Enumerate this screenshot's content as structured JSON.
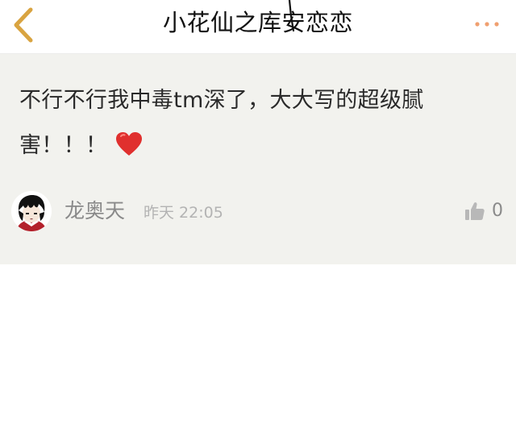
{
  "header": {
    "title": "小花仙之库安恋恋",
    "back_icon": "chevron-left-icon",
    "more_icon": "more-dots-icon",
    "accent_color": "#d9a441",
    "more_color": "#f0a070"
  },
  "comment": {
    "text": "不行不行我中毒tm深了，大大写的超级腻害！！！",
    "emoji_icon": "red-heart-icon",
    "author": "龙奥天",
    "timestamp": "昨天 22:05",
    "like_icon": "thumbs-up-icon",
    "like_count": "0",
    "background_color": "#f2f2ee"
  }
}
